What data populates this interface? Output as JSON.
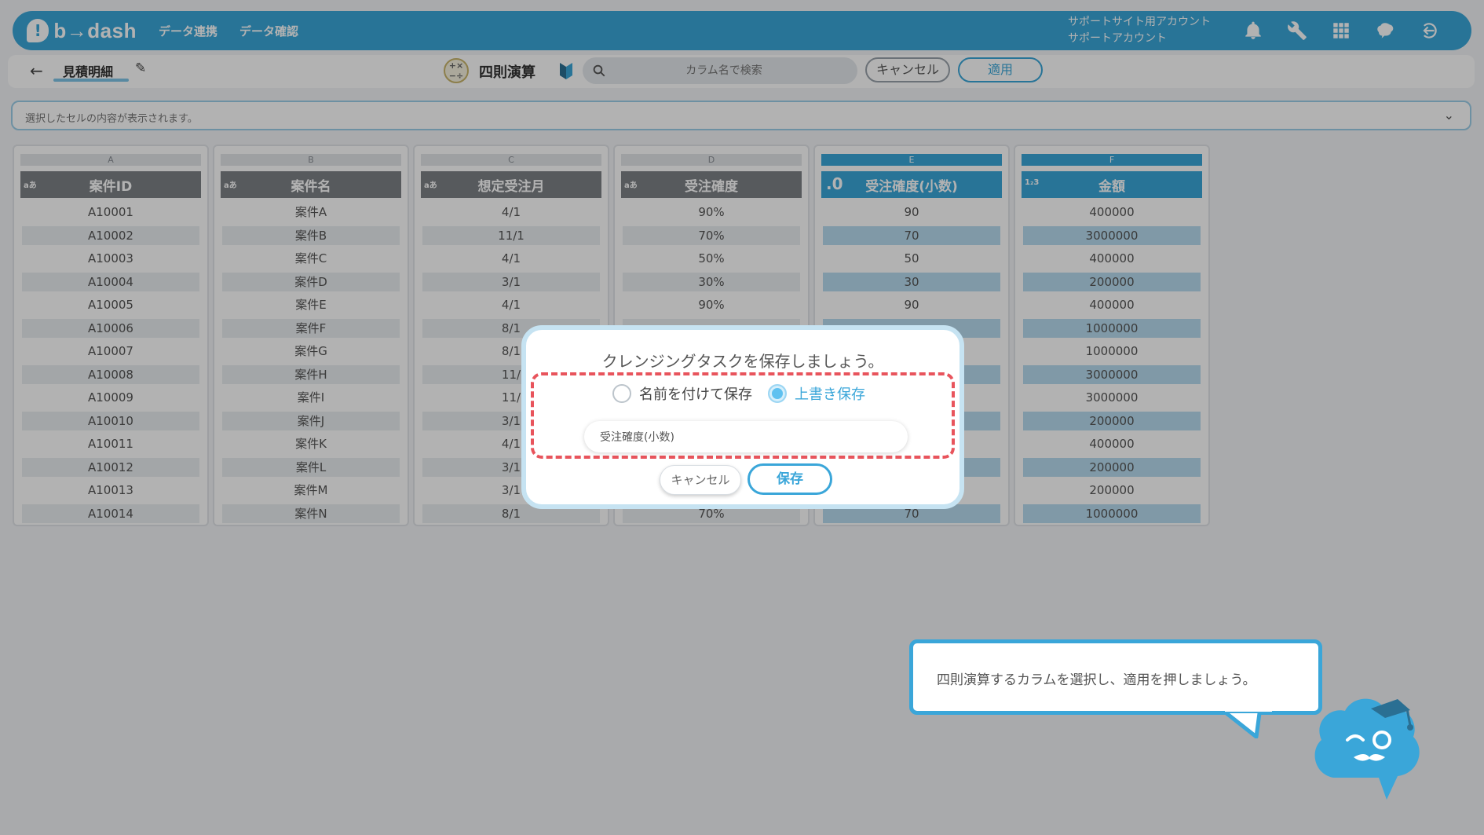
{
  "app": {
    "logo_mark": "!",
    "logo_text": "b→dash",
    "nav": [
      "データ連携",
      "データ確認"
    ],
    "account_line1": "サポートサイト用アカウント",
    "account_line2": "サポートアカウント",
    "brand_color": "#3aa6d9"
  },
  "subbar": {
    "back_label": "←",
    "sheet_name": "見積明細",
    "tool_title": "四則演算",
    "search_placeholder": "カラム名で検索",
    "cancel_label": "キャンセル",
    "apply_label": "適用"
  },
  "preview": {
    "text": "選択したセルの内容が表示されます。",
    "chevron": "⌄"
  },
  "grid": {
    "columns": [
      {
        "letter": "A",
        "type": "aあ",
        "header": "案件ID",
        "cells": [
          "A10001",
          "A10002",
          "A10003",
          "A10004",
          "A10005",
          "A10006",
          "A10007",
          "A10008",
          "A10009",
          "A10010",
          "A10011",
          "A10012",
          "A10013",
          "A10014"
        ]
      },
      {
        "letter": "B",
        "type": "aあ",
        "header": "案件名",
        "cells": [
          "案件A",
          "案件B",
          "案件C",
          "案件D",
          "案件E",
          "案件F",
          "案件G",
          "案件H",
          "案件I",
          "案件J",
          "案件K",
          "案件L",
          "案件M",
          "案件N"
        ]
      },
      {
        "letter": "C",
        "type": "aあ",
        "header": "想定受注月",
        "cells": [
          "4/1",
          "11/1",
          "4/1",
          "3/1",
          "4/1",
          "8/1",
          "8/1",
          "11/",
          "11/",
          "3/1",
          "4/1",
          "3/1",
          "3/1",
          "8/1"
        ]
      },
      {
        "letter": "D",
        "type": "aあ",
        "header": "受注確度",
        "cells": [
          "90%",
          "70%",
          "50%",
          "30%",
          "90%",
          "",
          "",
          "",
          "",
          "",
          "",
          "",
          "",
          "70%"
        ]
      },
      {
        "letter": "E",
        "type": ".0",
        "header": "受注確度(小数)",
        "selected": true,
        "cells": [
          "90",
          "70",
          "50",
          "30",
          "90",
          "",
          "",
          "",
          "",
          "",
          "",
          "",
          "",
          "70"
        ]
      },
      {
        "letter": "F",
        "type": "1₂3",
        "header": "金額",
        "selected": true,
        "cells": [
          "400000",
          "3000000",
          "400000",
          "200000",
          "400000",
          "1000000",
          "1000000",
          "3000000",
          "3000000",
          "200000",
          "400000",
          "200000",
          "200000",
          "1000000"
        ]
      }
    ]
  },
  "modal": {
    "title": "クレンジングタスクを保存しましょう。",
    "option_new": "名前を付けて保存",
    "option_overwrite": "上書き保存",
    "selected_option": "上書き保存",
    "name_value": "受注確度(小数)",
    "cancel_label": "キャンセル",
    "save_label": "保存",
    "highlight_color": "#e8545c"
  },
  "tooltip": {
    "text": "四則演算するカラムを選択し、適用を押しましょう。"
  }
}
